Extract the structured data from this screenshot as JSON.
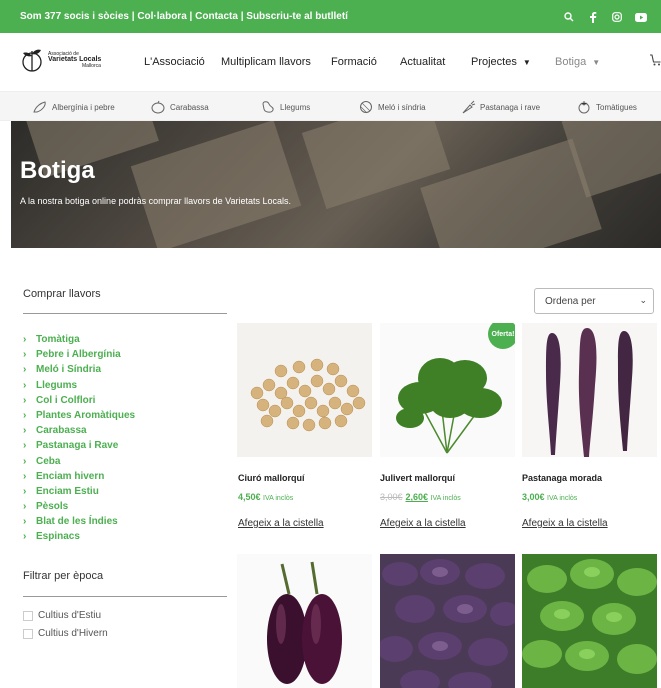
{
  "topbar": {
    "link_members": "Som 377 socis i sòcies",
    "link_collabora": "Col·labora",
    "link_contacta": "Contacta",
    "link_subscriu": "Subscriu-te al butlletí",
    "separator": " | ",
    "icons": [
      "search-icon",
      "facebook-icon",
      "instagram-icon",
      "youtube-icon"
    ]
  },
  "logo": {
    "line1": "Associació de",
    "line2": "Varietats Locals",
    "line3": "Mallorca"
  },
  "nav": {
    "associacio": "L'Associació",
    "multiplicam": "Multiplicam llavors",
    "formacio": "Formació",
    "actualitat": "Actualitat",
    "projectes": "Projectes",
    "botiga": "Botiga"
  },
  "categories_strip": [
    "Albergínia i pebre",
    "Carabassa",
    "Llegums",
    "Meló i síndria",
    "Pastanaga i rave",
    "Tomàtigues"
  ],
  "hero": {
    "title": "Botiga",
    "subtitle": "A la nostra botiga online podràs comprar llavors de Varietats Locals."
  },
  "sidebar": {
    "buy_title": "Comprar llavors",
    "categories": [
      "Tomàtiga",
      "Pebre i Albergínia",
      "Meló i Síndria",
      "Llegums",
      "Col i Colflori",
      "Plantes Aromàtiques",
      "Carabassa",
      "Pastanaga i Rave",
      "Ceba",
      "Enciam hivern",
      "Enciam Estiu",
      "Pèsols",
      "Blat de les Índies",
      "Espinacs"
    ],
    "filter_title": "Filtrar per època",
    "filters": [
      "Cultius d'Estiu",
      "Cultius d'Hivern"
    ]
  },
  "sort": {
    "label": "Ordena per"
  },
  "products": [
    {
      "name": "Ciuró mallorquí",
      "price": "4,50€",
      "iva": "IVA inclòs",
      "add": "Afegeix a la cistella"
    },
    {
      "name": "Julivert mallorquí",
      "old_price": "3,00€",
      "price": "2,60€",
      "iva": "IVA inclòs",
      "add": "Afegeix a la cistella",
      "badge": "Oferta!"
    },
    {
      "name": "Pastanaga morada",
      "price": "3,00€",
      "iva": "IVA inclòs",
      "add": "Afegeix a la cistella"
    }
  ],
  "colors": {
    "brand_green": "#4caf50",
    "text_dark": "#222222"
  }
}
